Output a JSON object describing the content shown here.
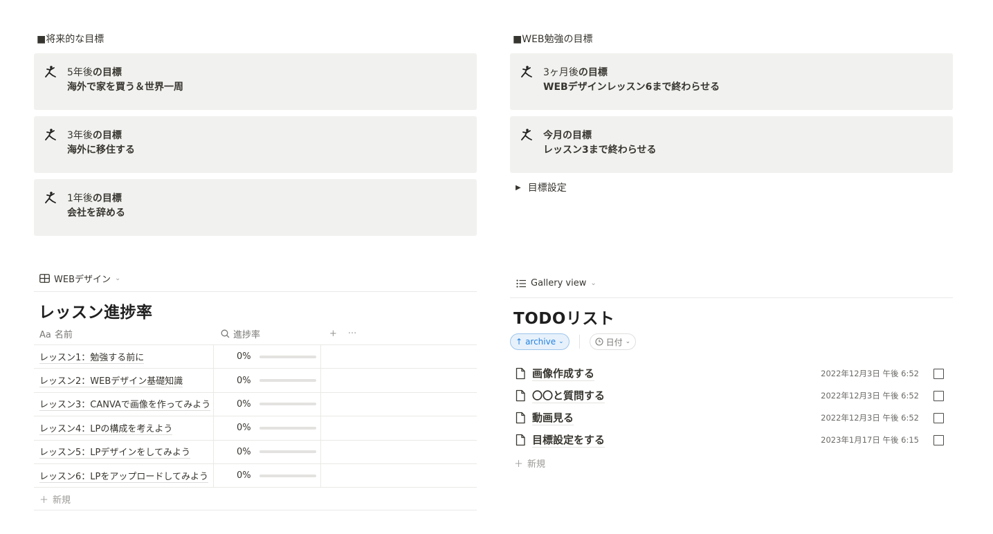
{
  "left": {
    "heading": "■将来的な目標",
    "callouts": [
      {
        "prefix": "5年後",
        "suffix": "の目標",
        "body": "海外で家を買う＆世界一周"
      },
      {
        "prefix": "3年後",
        "suffix": "の目標",
        "body": "海外に移住する"
      },
      {
        "prefix": "1年後",
        "suffix": "の目標",
        "body": "会社を辞める"
      }
    ],
    "view_tab": "WEBデザイン",
    "db_title": "レッスン進捗率",
    "columns": {
      "name_icon": "Aa",
      "name": "名前",
      "progress": "進捗率",
      "add": "+",
      "more": "···"
    },
    "rows": [
      {
        "name": "レッスン1：勉強する前に",
        "progress_text": "0%",
        "progress": 0
      },
      {
        "name": "レッスン2：WEBデザイン基礎知識",
        "progress_text": "0%",
        "progress": 0
      },
      {
        "name": "レッスン3：CANVAで画像を作ってみよう",
        "progress_text": "0%",
        "progress": 0
      },
      {
        "name": "レッスン4：LPの構成を考えよう",
        "progress_text": "0%",
        "progress": 0
      },
      {
        "name": "レッスン5：LPデザインをしてみよう",
        "progress_text": "0%",
        "progress": 0
      },
      {
        "name": "レッスン6：LPをアップロードしてみよう",
        "progress_text": "0%",
        "progress": 0
      }
    ],
    "new_label": "新規"
  },
  "right": {
    "heading": "■WEB勉強の目標",
    "callouts": [
      {
        "prefix": "3ヶ月後",
        "suffix": "の目標",
        "body": "WEBデザインレッスン6まで終わらせる"
      },
      {
        "prefix": "今月",
        "suffix": "の目標",
        "body": "レッスン3まで終わらせる"
      }
    ],
    "toggle": "目標設定",
    "view_tab": "Gallery view",
    "db_title": "TODOリスト",
    "filter_sort": "archive",
    "filter_date": "日付",
    "todos": [
      {
        "title": "画像作成する",
        "date": "2022年12月3日 午後 6:52",
        "done": false
      },
      {
        "title": "〇〇と質問する",
        "date": "2022年12月3日 午後 6:52",
        "done": false
      },
      {
        "title": "動画見る",
        "date": "2022年12月3日 午後 6:52",
        "done": false
      },
      {
        "title": "目標設定をする",
        "date": "2023年1月17日 午後 6:15",
        "done": false
      }
    ],
    "new_label": "新規"
  },
  "colors": {
    "accent": "#2383e2",
    "callout_bg": "#f1f1ef",
    "text": "#37352f",
    "muted": "#787774"
  },
  "icons": {
    "callout": "jumpman-icon",
    "page": "page-icon",
    "table_view": "table-icon",
    "list_view": "list-icon"
  }
}
